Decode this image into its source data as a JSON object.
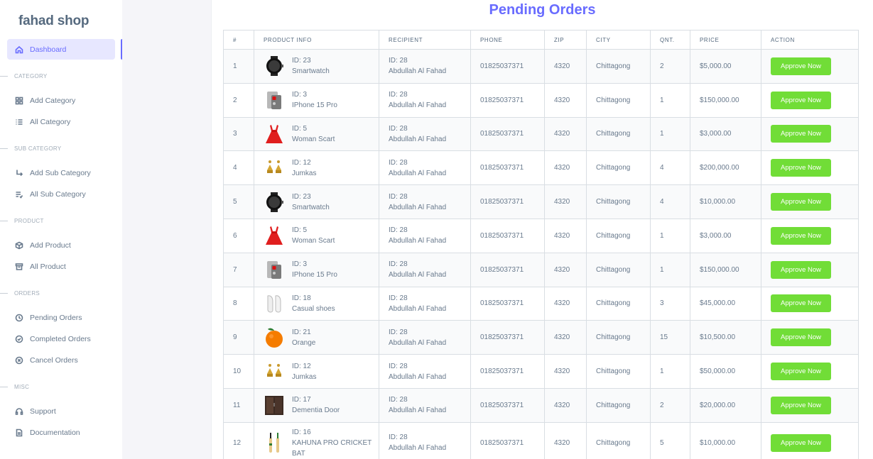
{
  "brand": "fahad shop",
  "nav": {
    "dashboard": "Dashboard",
    "sec_category": "CATEGORY",
    "add_category": "Add Category",
    "all_category": "All Category",
    "sec_sub_category": "SUB CATEGORY",
    "add_sub_category": "Add Sub Category",
    "all_sub_category": "All Sub Category",
    "sec_product": "PRODUCT",
    "add_product": "Add Product",
    "all_product": "All Product",
    "sec_orders": "ORDERS",
    "pending_orders": "Pending Orders",
    "completed_orders": "Completed Orders",
    "cancel_orders": "Cancel Orders",
    "sec_misc": "MISC",
    "support": "Support",
    "documentation": "Documentation"
  },
  "page": {
    "title": "Pending Orders"
  },
  "colors": {
    "accent": "#696cff",
    "approve": "#71dd37"
  },
  "table": {
    "headers": [
      "#",
      "PRODUCT INFO",
      "RECIPIENT",
      "PHONE",
      "ZIP",
      "CITY",
      "QNT.",
      "PRICE",
      "ACTION"
    ],
    "rows": [
      {
        "num": "1",
        "thumb": "smartwatch-image",
        "pid": "ID: 23",
        "pname": "Smartwatch",
        "rid": "ID: 28",
        "rname": "Abdullah Al Fahad",
        "phone": "01825037371",
        "zip": "4320",
        "city": "Chittagong",
        "qnt": "2",
        "price": "$5,000.00",
        "action": "Approve Now"
      },
      {
        "num": "2",
        "thumb": "phone-image",
        "pid": "ID: 3",
        "pname": "IPhone 15 Pro",
        "rid": "ID: 28",
        "rname": "Abdullah Al Fahad",
        "phone": "01825037371",
        "zip": "4320",
        "city": "Chittagong",
        "qnt": "1",
        "price": "$150,000.00",
        "action": "Approve Now"
      },
      {
        "num": "3",
        "thumb": "dress-image",
        "pid": "ID: 5",
        "pname": "Woman Scart",
        "rid": "ID: 28",
        "rname": "Abdullah Al Fahad",
        "phone": "01825037371",
        "zip": "4320",
        "city": "Chittagong",
        "qnt": "1",
        "price": "$3,000.00",
        "action": "Approve Now"
      },
      {
        "num": "4",
        "thumb": "earrings-image",
        "pid": "ID: 12",
        "pname": "Jumkas",
        "rid": "ID: 28",
        "rname": "Abdullah Al Fahad",
        "phone": "01825037371",
        "zip": "4320",
        "city": "Chittagong",
        "qnt": "4",
        "price": "$200,000.00",
        "action": "Approve Now"
      },
      {
        "num": "5",
        "thumb": "smartwatch-image",
        "pid": "ID: 23",
        "pname": "Smartwatch",
        "rid": "ID: 28",
        "rname": "Abdullah Al Fahad",
        "phone": "01825037371",
        "zip": "4320",
        "city": "Chittagong",
        "qnt": "4",
        "price": "$10,000.00",
        "action": "Approve Now"
      },
      {
        "num": "6",
        "thumb": "dress-image",
        "pid": "ID: 5",
        "pname": "Woman Scart",
        "rid": "ID: 28",
        "rname": "Abdullah Al Fahad",
        "phone": "01825037371",
        "zip": "4320",
        "city": "Chittagong",
        "qnt": "1",
        "price": "$3,000.00",
        "action": "Approve Now"
      },
      {
        "num": "7",
        "thumb": "phone-image",
        "pid": "ID: 3",
        "pname": "IPhone 15 Pro",
        "rid": "ID: 28",
        "rname": "Abdullah Al Fahad",
        "phone": "01825037371",
        "zip": "4320",
        "city": "Chittagong",
        "qnt": "1",
        "price": "$150,000.00",
        "action": "Approve Now"
      },
      {
        "num": "8",
        "thumb": "shoes-image",
        "pid": "ID: 18",
        "pname": "Casual shoes",
        "rid": "ID: 28",
        "rname": "Abdullah Al Fahad",
        "phone": "01825037371",
        "zip": "4320",
        "city": "Chittagong",
        "qnt": "3",
        "price": "$45,000.00",
        "action": "Approve Now"
      },
      {
        "num": "9",
        "thumb": "orange-image",
        "pid": "ID: 21",
        "pname": "Orange",
        "rid": "ID: 28",
        "rname": "Abdullah Al Fahad",
        "phone": "01825037371",
        "zip": "4320",
        "city": "Chittagong",
        "qnt": "15",
        "price": "$10,500.00",
        "action": "Approve Now"
      },
      {
        "num": "10",
        "thumb": "earrings-image",
        "pid": "ID: 12",
        "pname": "Jumkas",
        "rid": "ID: 28",
        "rname": "Abdullah Al Fahad",
        "phone": "01825037371",
        "zip": "4320",
        "city": "Chittagong",
        "qnt": "1",
        "price": "$50,000.00",
        "action": "Approve Now"
      },
      {
        "num": "11",
        "thumb": "door-image",
        "pid": "ID: 17",
        "pname": "Dementia Door",
        "rid": "ID: 28",
        "rname": "Abdullah Al Fahad",
        "phone": "01825037371",
        "zip": "4320",
        "city": "Chittagong",
        "qnt": "2",
        "price": "$20,000.00",
        "action": "Approve Now"
      },
      {
        "num": "12",
        "thumb": "cricket-bat-image",
        "pid": "ID: 16",
        "pname": "KAHUNA PRO CRICKET BAT",
        "rid": "ID: 28",
        "rname": "Abdullah Al Fahad",
        "phone": "01825037371",
        "zip": "4320",
        "city": "Chittagong",
        "qnt": "5",
        "price": "$10,000.00",
        "action": "Approve Now"
      }
    ]
  }
}
